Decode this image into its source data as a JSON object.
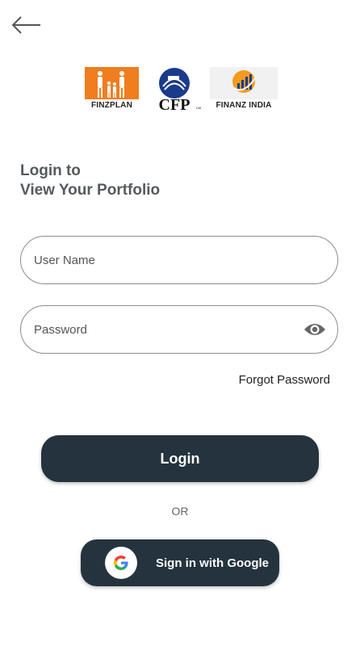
{
  "nav": {
    "back_icon": "arrow-left-icon"
  },
  "logos": [
    {
      "name": "finzplan",
      "caption": "FINZPLAN",
      "color": "#f07d1e"
    },
    {
      "name": "cfp",
      "caption": "CFP",
      "mark": "CM",
      "color": "#1a3a8c"
    },
    {
      "name": "finanz-india",
      "caption": "FINANZ INDIA",
      "color": "#f39c1f"
    }
  ],
  "heading": {
    "line1": "Login to",
    "line2": "View Your Portfolio"
  },
  "form": {
    "username_placeholder": "User Name",
    "password_placeholder": "Password",
    "password_toggle_icon": "eye-icon",
    "forgot_label": "Forgot Password",
    "login_label": "Login",
    "or_label": "OR",
    "google_label": "Sign in with Google",
    "google_icon": "google-g-icon"
  },
  "colors": {
    "primary_button": "#24333d",
    "heading": "#555a5e",
    "field_border": "#8a8d90"
  }
}
